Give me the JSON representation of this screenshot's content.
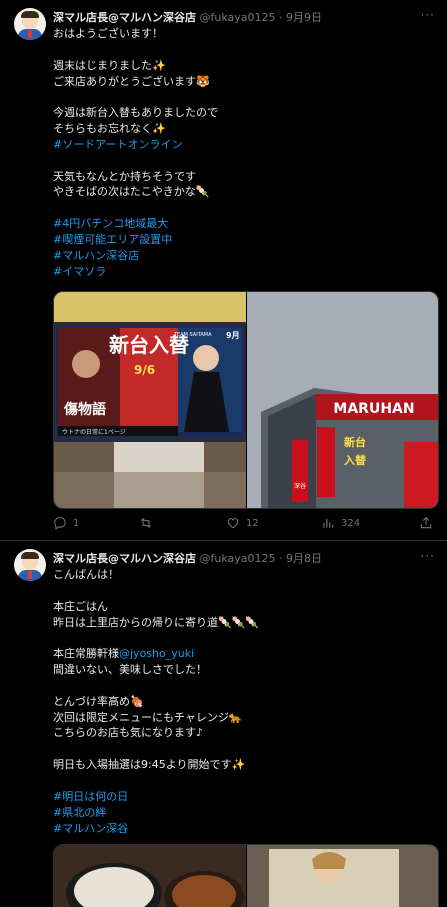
{
  "tweets": [
    {
      "author_name": "深マル店長@マルハン深谷店",
      "handle": "@fukaya0125",
      "date": "9月9日",
      "more_label": "···",
      "lines": [
        {
          "text": "おはようございます！",
          "tag": false
        },
        {
          "text": "",
          "tag": false
        },
        {
          "text": "週末はじまりました✨",
          "tag": false
        },
        {
          "text": "ご来店ありがとうございます🐯",
          "tag": false
        },
        {
          "text": "",
          "tag": false
        },
        {
          "text": "今週は新台入替もありましたので",
          "tag": false
        },
        {
          "text": "そちらもお忘れなく✨",
          "tag": false
        },
        {
          "text": "#ソードアートオンライン",
          "tag": true
        },
        {
          "text": "",
          "tag": false
        },
        {
          "text": "天気もなんとか持ちそうです",
          "tag": false
        },
        {
          "text": "やきそばの次はたこやきかな🍡",
          "tag": false
        },
        {
          "text": "",
          "tag": false
        },
        {
          "text": "#4円パチンコ地域最大",
          "tag": true
        },
        {
          "text": "#喫煙可能エリア設置中",
          "tag": true
        },
        {
          "text": "#マルハン深谷店",
          "tag": true
        },
        {
          "text": "#イマソラ",
          "tag": true
        }
      ],
      "media": {
        "left_texts": {
          "banner": "新台入替",
          "team": "TEAM SAITAMA",
          "date": "9/6",
          "monogatari": "傷物語",
          "date_tag": "9月",
          "caption": "ウトナの日常に1ページ"
        },
        "right_texts": {
          "sign": "MARUHAN",
          "banner1": "新台",
          "banner2": "入替",
          "banner3": "深谷"
        }
      },
      "stats": {
        "replies": "1",
        "retweets": "",
        "likes": "12",
        "views": "324"
      }
    },
    {
      "author_name": "深マル店長@マルハン深谷店",
      "handle": "@fukaya0125",
      "date": "9月8日",
      "more_label": "···",
      "lines": [
        {
          "text": "こんばんは！",
          "tag": false
        },
        {
          "text": "",
          "tag": false
        },
        {
          "text": "本庄ごはん",
          "tag": false
        },
        {
          "text": "昨日は上里店からの帰りに寄り道🍡🍡🍡",
          "tag": false
        },
        {
          "text": "",
          "tag": false
        },
        {
          "text": "本庄常勝軒様@jyosho_yuki",
          "tag": false,
          "mention_from": 6
        },
        {
          "text": "間違いない、美味しさでした！",
          "tag": false
        },
        {
          "text": "",
          "tag": false
        },
        {
          "text": "とんづけ率高め🍖",
          "tag": false
        },
        {
          "text": "次回は限定メニューにもチャレンジ🐆",
          "tag": false
        },
        {
          "text": "こちらのお店も気になります♪",
          "tag": false
        },
        {
          "text": "",
          "tag": false
        },
        {
          "text": "明日も入場抽選は9:45より開始です✨",
          "tag": false
        },
        {
          "text": "",
          "tag": false
        },
        {
          "text": "#明日は何の日",
          "tag": true
        },
        {
          "text": "#県北の絆",
          "tag": true
        },
        {
          "text": "#マルハン深谷",
          "tag": true
        }
      ]
    }
  ]
}
